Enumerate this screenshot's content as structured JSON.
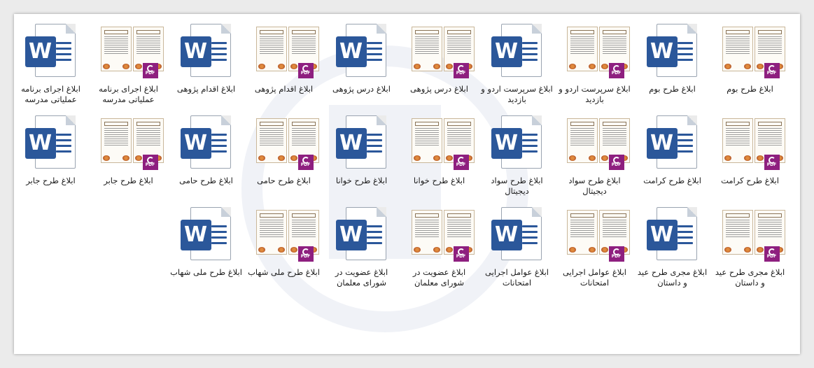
{
  "files": [
    {
      "name": "ابلاغ طرح بوم",
      "type": "pdf",
      "icon": "pdf-file-icon"
    },
    {
      "name": "ابلاغ طرح بوم",
      "type": "word",
      "icon": "word-file-icon"
    },
    {
      "name": "ابلاغ سرپرست اردو و بازدید",
      "type": "pdf",
      "icon": "pdf-file-icon"
    },
    {
      "name": "ابلاغ سرپرست اردو و بازدید",
      "type": "word",
      "icon": "word-file-icon"
    },
    {
      "name": "ابلاغ درس پژوهی",
      "type": "pdf",
      "icon": "pdf-file-icon"
    },
    {
      "name": "ابلاغ درس پژوهی",
      "type": "word",
      "icon": "word-file-icon"
    },
    {
      "name": "ابلاغ اقدام پژوهی",
      "type": "pdf",
      "icon": "pdf-file-icon"
    },
    {
      "name": "ابلاغ اقدام پژوهی",
      "type": "word",
      "icon": "word-file-icon"
    },
    {
      "name": "ابلاغ اجرای برنامه عملیاتی مدرسه",
      "type": "pdf",
      "icon": "pdf-file-icon"
    },
    {
      "name": "ابلاغ اجرای برنامه عملیاتی مدرسه",
      "type": "word",
      "icon": "word-file-icon"
    },
    {
      "name": "ابلاغ طرح کرامت",
      "type": "pdf",
      "icon": "pdf-file-icon"
    },
    {
      "name": "ابلاغ طرح کرامت",
      "type": "word",
      "icon": "word-file-icon"
    },
    {
      "name": "ابلاغ طرح سواد دیجیتال",
      "type": "pdf",
      "icon": "pdf-file-icon"
    },
    {
      "name": "ابلاغ طرح سواد دیجیتال",
      "type": "word",
      "icon": "word-file-icon"
    },
    {
      "name": "ابلاغ طرح خوانا",
      "type": "pdf",
      "icon": "pdf-file-icon"
    },
    {
      "name": "ابلاغ طرح خوانا",
      "type": "word",
      "icon": "word-file-icon"
    },
    {
      "name": "ابلاغ طرح حامی",
      "type": "pdf",
      "icon": "pdf-file-icon"
    },
    {
      "name": "ابلاغ طرح حامی",
      "type": "word",
      "icon": "word-file-icon"
    },
    {
      "name": "ابلاغ طرح جابر",
      "type": "pdf",
      "icon": "pdf-file-icon"
    },
    {
      "name": "ابلاغ طرح جابر",
      "type": "word",
      "icon": "word-file-icon"
    },
    {
      "name": "ابلاغ مجری طرح عید و داستان",
      "type": "pdf",
      "icon": "pdf-file-icon"
    },
    {
      "name": "ابلاغ مجری طرح عید و داستان",
      "type": "word",
      "icon": "word-file-icon"
    },
    {
      "name": "ابلاغ عوامل اجرایی امتحانات",
      "type": "pdf",
      "icon": "pdf-file-icon"
    },
    {
      "name": "ابلاغ عوامل اجرایی امتحانات",
      "type": "word",
      "icon": "word-file-icon"
    },
    {
      "name": "ابلاغ عضویت در شورای معلمان",
      "type": "pdf",
      "icon": "pdf-file-icon"
    },
    {
      "name": "ابلاغ عضویت در شورای معلمان",
      "type": "word",
      "icon": "word-file-icon"
    },
    {
      "name": "ابلاغ طرح ملی شهاب",
      "type": "pdf",
      "icon": "pdf-file-icon"
    },
    {
      "name": "ابلاغ طرح ملی شهاب",
      "type": "word",
      "icon": "word-file-icon"
    }
  ],
  "badges": {
    "word_letter": "W",
    "pdf_text": "PDF"
  },
  "colors": {
    "word_blue": "#2b579a",
    "pdf_purple": "#8e1f7f"
  }
}
